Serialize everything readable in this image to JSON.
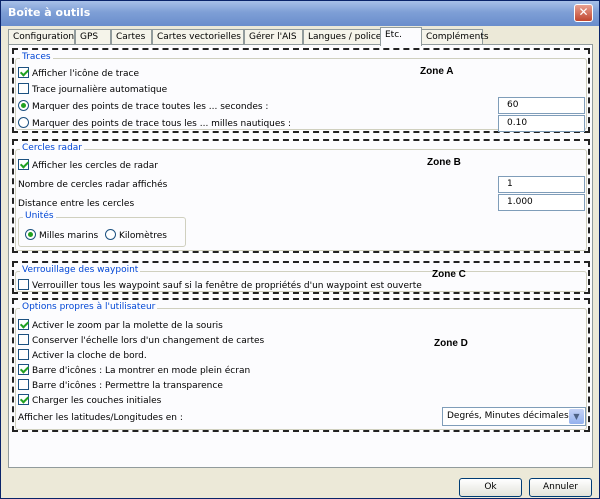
{
  "window": {
    "title": "Boîte à outils",
    "close_glyph": "✕"
  },
  "tabs": [
    {
      "label": "Configuration"
    },
    {
      "label": "GPS"
    },
    {
      "label": "Cartes"
    },
    {
      "label": "Cartes vectorielles"
    },
    {
      "label": "Gérer l'AIS"
    },
    {
      "label": "Langues / polices"
    },
    {
      "label": "Etc."
    },
    {
      "label": "Compléments"
    }
  ],
  "active_tab": "Etc.",
  "zone_a": {
    "label": "Zone A",
    "legend": "Traces",
    "show_trace_icon": {
      "label": "Afficher l'icône de trace",
      "checked": true
    },
    "daily_trace": {
      "label": "Trace journalière automatique",
      "checked": false
    },
    "by_seconds": {
      "label": "Marquer des points de trace toutes les ... secondes :",
      "selected": true,
      "value": "60"
    },
    "by_miles": {
      "label": "Marquer des points de trace tous les ... milles nautiques :",
      "selected": false,
      "value": "0.10"
    }
  },
  "zone_b": {
    "label": "Zone B",
    "legend": "Cercles radar",
    "show_rings": {
      "label": "Afficher les cercles de radar",
      "checked": true
    },
    "ring_count": {
      "label": "Nombre de cercles radar affichés",
      "value": "1"
    },
    "ring_distance": {
      "label": "Distance entre les cercles",
      "value": "1.000"
    },
    "units": {
      "legend": "Unités",
      "nautical_miles": {
        "label": "Milles marins",
        "selected": true
      },
      "kilometers": {
        "label": "Kilomètres",
        "selected": false
      }
    }
  },
  "zone_c": {
    "label": "Zone C",
    "legend": "Verrouillage des waypoint",
    "lock_waypoints": {
      "label": "Verrouiller tous les waypoint sauf si la fenêtre de propriétés d'un waypoint est ouverte",
      "checked": false
    }
  },
  "zone_d": {
    "label": "Zone D",
    "legend": "Options propres à l'utilisateur",
    "options": [
      {
        "label": "Activer le zoom par la molette de la souris",
        "checked": true
      },
      {
        "label": "Conserver l'échelle lors d'un changement de cartes",
        "checked": false
      },
      {
        "label": "Activer la cloche de bord.",
        "checked": false
      },
      {
        "label": "Barre d'icônes : La montrer en mode plein écran",
        "checked": true
      },
      {
        "label": "Barre d'icônes : Permettre la transparence",
        "checked": false
      },
      {
        "label": "Charger les couches initiales",
        "checked": true
      }
    ],
    "latlon_label": "Afficher les latitudes/Longitudes en :",
    "latlon_value": "Degrés, Minutes décimales"
  },
  "buttons": {
    "ok": "Ok",
    "cancel": "Annuler"
  },
  "icons": {
    "dropdown": "chevron-down-icon",
    "close": "close-icon"
  }
}
